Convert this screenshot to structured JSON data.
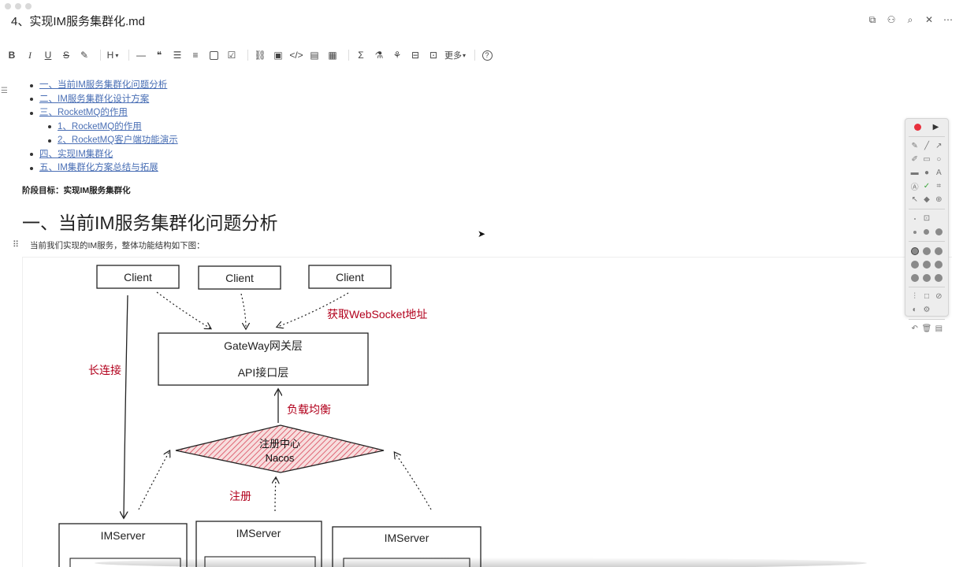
{
  "window": {
    "title": "4、实现IM服务集群化.md"
  },
  "top_actions": [
    "outline-icon",
    "share-icon",
    "find-icon",
    "fullscreen-icon",
    "more-icon"
  ],
  "toolbar": {
    "bold": "B",
    "italic": "I",
    "underline": "U",
    "strike": "S",
    "heading": "H",
    "more": "更多",
    "help": "?"
  },
  "toc": [
    {
      "label": "一、当前IM服务集群化问题分析",
      "level": 1
    },
    {
      "label": "二、IM服务集群化设计方案",
      "level": 1
    },
    {
      "label": "三、RocketMQ的作用",
      "level": 1
    },
    {
      "label": "1、RocketMQ的作用",
      "level": 2
    },
    {
      "label": "2、RocketMQ客户端功能演示",
      "level": 2
    },
    {
      "label": "四、实现IM集群化",
      "level": 1
    },
    {
      "label": "五、IM集群化方案总结与拓展",
      "level": 1
    }
  ],
  "content": {
    "goal": "阶段目标：实现IM服务集群化",
    "heading": "一、当前IM服务集群化问题分析",
    "intro": "当前我们实现的IM服务，整体功能结构如下图："
  },
  "diagram": {
    "client1": "Client",
    "client2": "Client",
    "client3": "Client",
    "gateway": "GateWay网关层",
    "api": "API接口层",
    "registry": "注册中心",
    "nacos": "Nacos",
    "server1": "IMServer",
    "server2": "IMServer",
    "server3": "IMServer",
    "label_ws": "获取WebSocket地址",
    "label_long": "长连接",
    "label_lb": "负载均衡",
    "label_reg": "注册",
    "accent_color": "#b2001c"
  }
}
